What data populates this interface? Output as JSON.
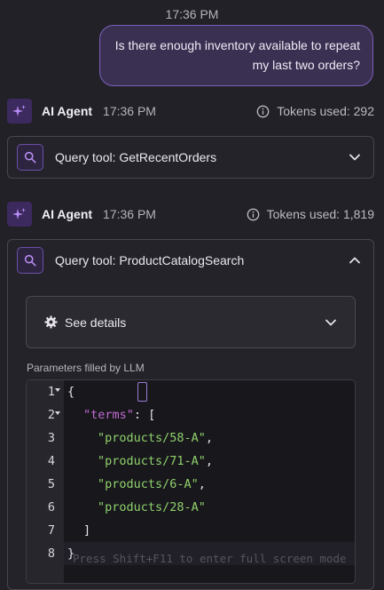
{
  "user_message": {
    "time": "17:36 PM",
    "lines": [
      "Is there enough inventory available to repeat",
      "my last two orders?"
    ]
  },
  "agent_entries": [
    {
      "name": "AI Agent",
      "time": "17:36 PM",
      "tokens_label": "Tokens used: 292",
      "tool": {
        "label": "Query tool: GetRecentOrders",
        "expanded": false
      }
    },
    {
      "name": "AI Agent",
      "time": "17:36 PM",
      "tokens_label": "Tokens used: 1,819",
      "tool": {
        "label": "Query tool: ProductCatalogSearch",
        "expanded": true,
        "details_label": "See details",
        "params_label": "Parameters filled by LLM",
        "code_lines": [
          {
            "n": "1",
            "text": "{"
          },
          {
            "n": "2",
            "key": "\"terms\"",
            "rest": ": ["
          },
          {
            "n": "3",
            "str": "\"products/58-A\"",
            "rest": ","
          },
          {
            "n": "4",
            "str": "\"products/71-A\"",
            "rest": ","
          },
          {
            "n": "5",
            "str": "\"products/6-A\"",
            "rest": ","
          },
          {
            "n": "6",
            "str": "\"products/28-A\"",
            "rest": ""
          },
          {
            "n": "7",
            "text": "]"
          },
          {
            "n": "8",
            "text": "}"
          }
        ],
        "editor_hint": "Press Shift+F11 to enter full screen mode"
      }
    }
  ],
  "colors": {
    "accent": "#7b5fb8",
    "background": "#222127",
    "json_key": "#c06bd3",
    "json_string": "#8fd16b"
  },
  "icons": [
    "sparkle-icon",
    "info-icon",
    "search-icon",
    "chevron-down-icon",
    "chevron-up-icon",
    "gear-icon",
    "fold-arrow-icon"
  ]
}
